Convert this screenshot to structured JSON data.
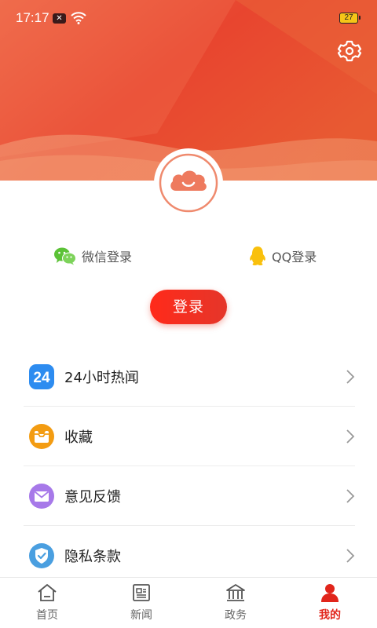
{
  "status_bar": {
    "time": "17:17",
    "battery_level": "27"
  },
  "header": {
    "icons": [
      "settings-icon"
    ],
    "colors": {
      "gradient_start": "#f08a5d",
      "gradient_end": "#e5402c"
    }
  },
  "profile": {
    "avatar_icon": "cloud-face-icon"
  },
  "social_login": {
    "wechat_label": "微信登录",
    "qq_label": "QQ登录"
  },
  "login": {
    "button_label": "登录",
    "color": "#f02a1c"
  },
  "menu": {
    "items": [
      {
        "label": "24小时热闻",
        "icon": "24h-news-icon",
        "color": "#2d8cf0"
      },
      {
        "label": "收藏",
        "icon": "favorites-box-icon",
        "color": "#f39c12"
      },
      {
        "label": "意见反馈",
        "icon": "feedback-mail-icon",
        "color": "#a779e9"
      },
      {
        "label": "隐私条款",
        "icon": "privacy-shield-icon",
        "color": "#4a9fe0"
      }
    ]
  },
  "tabbar": {
    "tabs": [
      {
        "label": "首页",
        "icon": "home-icon"
      },
      {
        "label": "新闻",
        "icon": "news-icon"
      },
      {
        "label": "政务",
        "icon": "government-icon"
      },
      {
        "label": "我的",
        "icon": "profile-icon",
        "active": true
      }
    ],
    "active_color": "#e1251b"
  }
}
